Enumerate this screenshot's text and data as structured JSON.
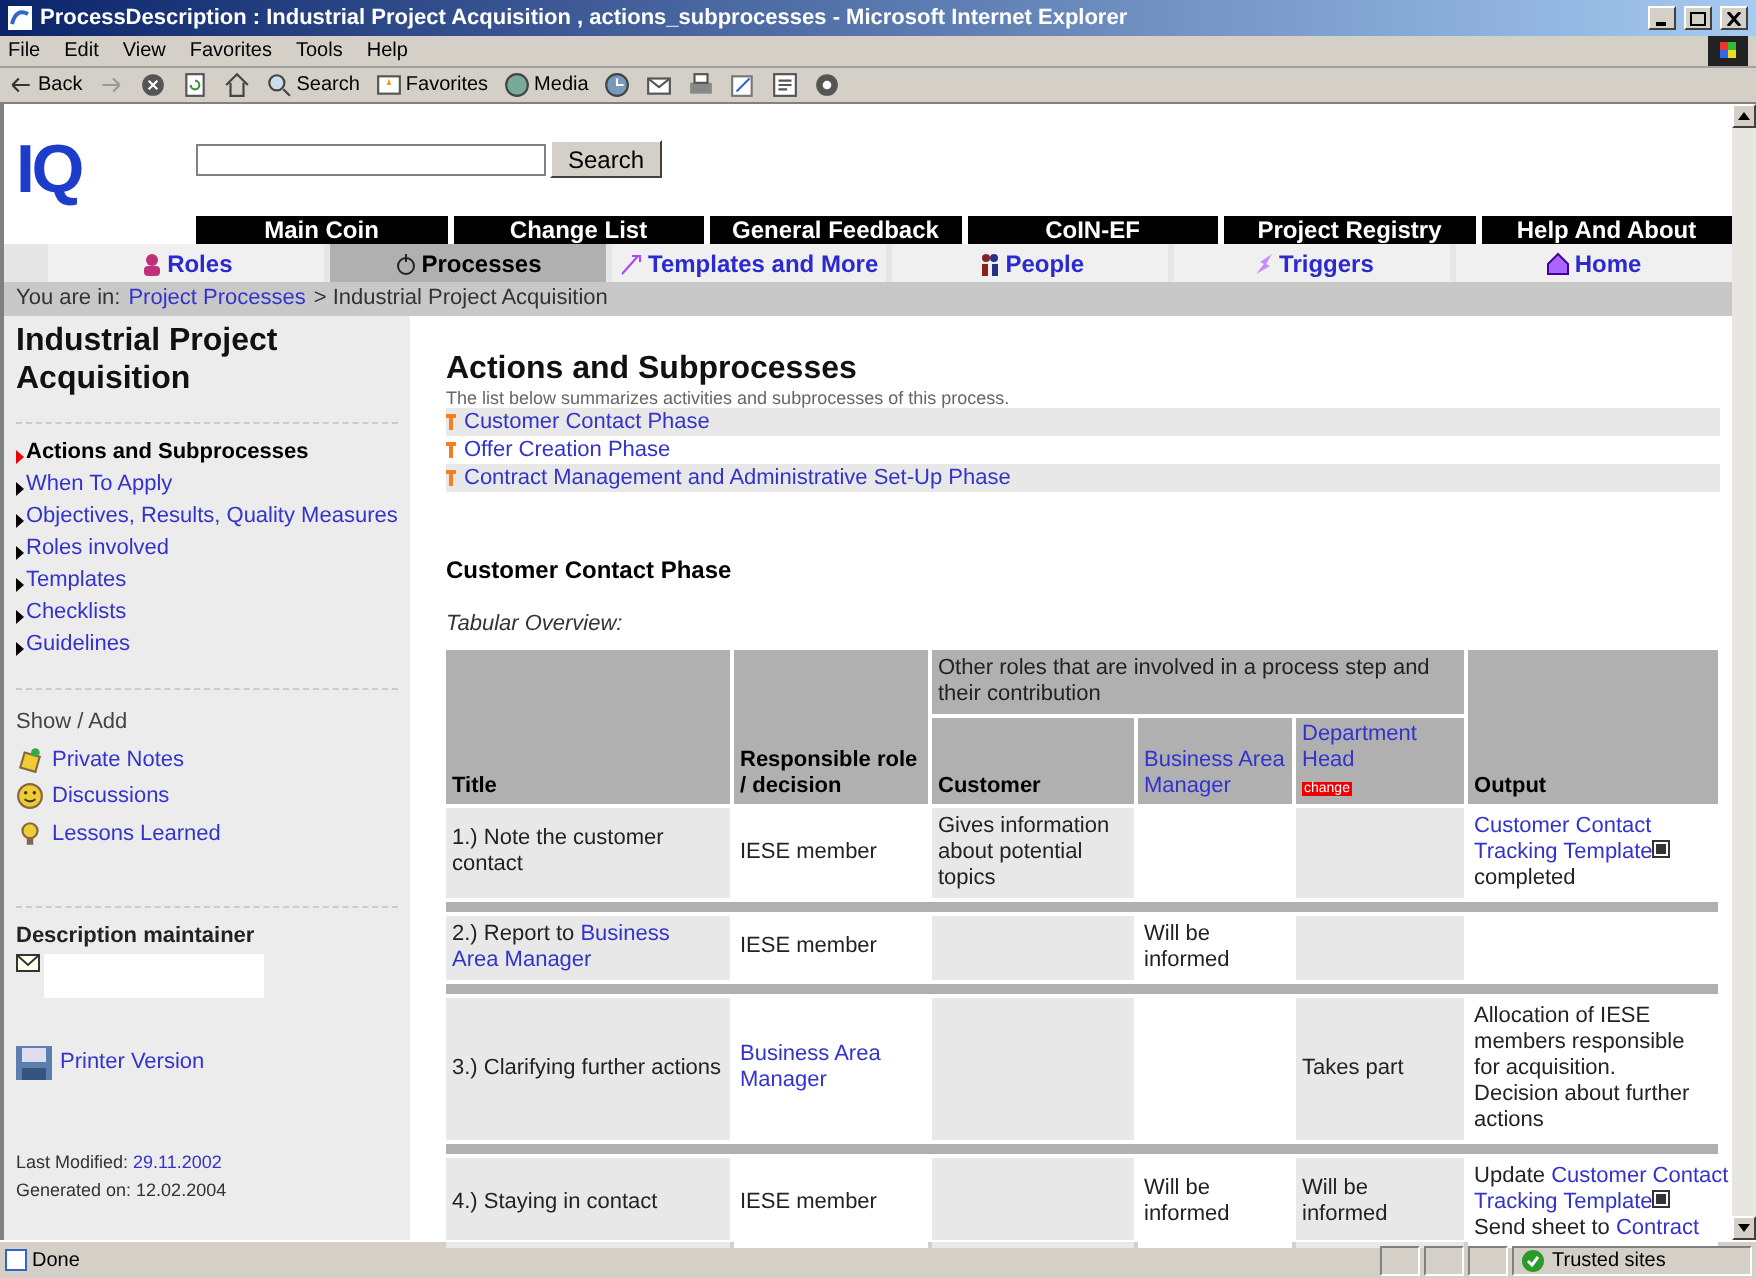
{
  "window": {
    "title": "ProcessDescription : Industrial Project Acquisition , actions_subprocesses - Microsoft Internet Explorer"
  },
  "menu": [
    "File",
    "Edit",
    "View",
    "Favorites",
    "Tools",
    "Help"
  ],
  "toolbar": [
    {
      "label": "Back",
      "kind": "back"
    },
    {
      "kind": "forward"
    },
    {
      "kind": "stop"
    },
    {
      "kind": "refresh"
    },
    {
      "kind": "home"
    },
    {
      "label": "Search",
      "kind": "search"
    },
    {
      "label": "Favorites",
      "kind": "favorites"
    },
    {
      "label": "Media",
      "kind": "media"
    },
    {
      "kind": "history"
    },
    {
      "kind": "mail"
    },
    {
      "kind": "print"
    },
    {
      "kind": "edit"
    },
    {
      "kind": "discuss"
    },
    {
      "kind": "messenger"
    }
  ],
  "logo": "IQ",
  "search": {
    "button": "Search"
  },
  "top_nav": [
    "Main Coin",
    "Change List",
    "General Feedback",
    "CoIN-EF",
    "Project Registry",
    "Help And About"
  ],
  "tabs": [
    {
      "label": "Roles",
      "selected": false,
      "kind": "roles"
    },
    {
      "label": "Processes",
      "selected": true,
      "kind": "processes"
    },
    {
      "label": "Templates and More",
      "selected": false,
      "kind": "templates"
    },
    {
      "label": "People",
      "selected": false,
      "kind": "people"
    },
    {
      "label": "Triggers",
      "selected": false,
      "kind": "triggers"
    },
    {
      "label": "Home",
      "selected": false,
      "kind": "home"
    }
  ],
  "breadcrumb": [
    {
      "text": "You are in:"
    },
    {
      "text": "Project Processes",
      "link": true
    },
    {
      "text": "> Industrial Project Acquisition"
    }
  ],
  "sidebar": {
    "title": "Industrial Project Acquisition",
    "sections": [
      {
        "label": "Actions and Subprocesses",
        "selected": true
      },
      {
        "label": "When To Apply",
        "selected": false
      },
      {
        "label": "Objectives, Results, Quality Measures",
        "selected": false
      },
      {
        "label": "Roles involved",
        "selected": false
      },
      {
        "label": "Templates",
        "selected": false
      },
      {
        "label": "Checklists",
        "selected": false
      },
      {
        "label": "Guidelines",
        "selected": false
      }
    ],
    "show_add": {
      "heading": "Show / Add",
      "items": [
        {
          "label": "Private Notes",
          "kind": "notes"
        },
        {
          "label": "Discussions",
          "kind": "discussions"
        },
        {
          "label": "Lessons Learned",
          "kind": "lessons"
        }
      ]
    },
    "maintainer_heading": "Description maintainer",
    "printer_version": "Printer Version",
    "last_modified": {
      "label": "Last Modified:",
      "date": "29.11.2002"
    },
    "generated": "Generated on: 12.02.2004"
  },
  "main": {
    "heading": "Actions and Subprocesses",
    "description": "The list below summarizes activities and subprocesses of this process.",
    "phases": [
      "Customer Contact Phase",
      "Offer Creation Phase",
      "Contract Management and Administrative Set-Up Phase"
    ],
    "section_heading": "Customer Contact Phase",
    "table_caption": "Tabular Overview:",
    "table": {
      "group_header": "Other roles that are involved in a process step and their contribution",
      "columns": [
        {
          "label": "Title",
          "link": false
        },
        {
          "label": "Responsible role / decision",
          "link": false
        },
        {
          "label": "Customer",
          "link": false
        },
        {
          "label": "Business Area Manager",
          "link": true
        },
        {
          "label": "Department Head",
          "link": true,
          "badge": "change"
        },
        {
          "label": "Output",
          "link": false
        }
      ],
      "rows": [
        [
          [
            [
              {
                "text": "1.) Note the customer contact"
              }
            ]
          ],
          [
            [
              {
                "text": "IESE member"
              }
            ]
          ],
          [
            [
              {
                "text": "Gives information about potential topics"
              }
            ]
          ],
          [],
          [],
          [
            [
              {
                "text": "Customer Contact",
                "link": true
              }
            ],
            [
              {
                "text": "Tracking Template",
                "link": true,
                "doc": true
              }
            ],
            [
              {
                "text": "completed"
              }
            ]
          ]
        ],
        [
          [
            [
              {
                "text": "2.) Report to "
              },
              {
                "text": "Business",
                "link": true
              }
            ],
            [
              {
                "text": "Area Manager",
                "link": true
              }
            ]
          ],
          [
            [
              {
                "text": "IESE member"
              }
            ]
          ],
          [],
          [
            [
              {
                "text": "Will be informed"
              }
            ]
          ],
          [],
          []
        ],
        [
          [
            [
              {
                "text": "3.) Clarifying further actions"
              }
            ]
          ],
          [
            [
              {
                "text": "Business Area",
                "link": true
              }
            ],
            [
              {
                "text": "Manager",
                "link": true
              }
            ]
          ],
          [],
          [],
          [
            [
              {
                "text": "Takes part"
              }
            ]
          ],
          [
            [
              {
                "text": "Allocation of IESE members responsible for acquisition."
              }
            ],
            [
              {
                "text": "Decision about further actions"
              }
            ]
          ]
        ],
        [
          [
            [
              {
                "text": "4.) Staying in contact"
              }
            ]
          ],
          [
            [
              {
                "text": "IESE member"
              }
            ]
          ],
          [],
          [
            [
              {
                "text": "Will be informed"
              }
            ]
          ],
          [
            [
              {
                "text": "Will be informed"
              }
            ]
          ],
          [
            [
              {
                "text": "Update "
              },
              {
                "text": "Customer Contact",
                "link": true
              }
            ],
            [
              {
                "text": "Tracking Template",
                "link": true,
                "doc": true
              }
            ],
            [
              {
                "text": "Send sheet to "
              },
              {
                "text": "Contract",
                "link": true
              }
            ]
          ]
        ]
      ]
    }
  },
  "status": {
    "text": "Done",
    "zone": "Trusted sites"
  }
}
